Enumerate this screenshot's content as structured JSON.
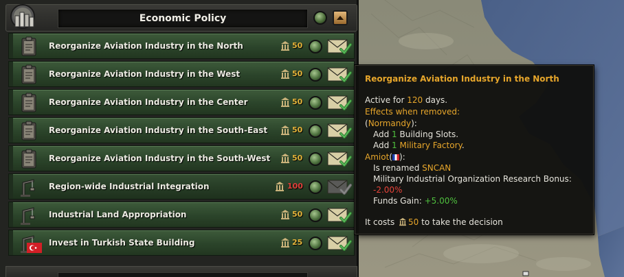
{
  "panel": {
    "title": "Economic Policy"
  },
  "decisions": [
    {
      "label": "Reorganize Aviation Industry in the North",
      "cost": "50",
      "icon": "clipboard-icon",
      "cost_color": "#e4b33a"
    },
    {
      "label": "Reorganize Aviation Industry in the West",
      "cost": "50",
      "icon": "clipboard-icon",
      "cost_color": "#e4b33a"
    },
    {
      "label": "Reorganize Aviation Industry in the Center",
      "cost": "50",
      "icon": "clipboard-icon",
      "cost_color": "#e4b33a"
    },
    {
      "label": "Reorganize Aviation Industry in the South-East",
      "cost": "50",
      "icon": "clipboard-icon",
      "cost_color": "#e4b33a"
    },
    {
      "label": "Reorganize Aviation Industry in the South-West",
      "cost": "50",
      "icon": "clipboard-icon",
      "cost_color": "#e4b33a"
    },
    {
      "label": "Region-wide Industrial Integration",
      "cost": "100",
      "icon": "crane-icon",
      "cost_color": "#e0403a"
    },
    {
      "label": "Industrial Land Appropriation",
      "cost": "50",
      "icon": "crane-icon",
      "cost_color": "#e4b33a"
    },
    {
      "label": "Invest in Turkish State Building",
      "cost": "25",
      "icon": "crane-icon",
      "cost_color": "#e4b33a"
    }
  ],
  "tooltip": {
    "title": "Reorganize Aviation Industry in the North",
    "active_prefix": "Active for ",
    "active_days": "120",
    "active_suffix": " days.",
    "effects_header": "Effects when removed:",
    "paren_open": "(",
    "state_name": "Normandy",
    "paren_close_colon": "):",
    "add1_prefix": "Add ",
    "add1_num": "1",
    "add1_suffix": " Building Slots.",
    "add2_prefix": "Add ",
    "add2_num": "1",
    "add2_suffix": " Military Factory",
    "add2_period": ".",
    "company_name": "Amiot",
    "company_close": "):",
    "renamed_prefix": "Is renamed ",
    "renamed_name": "SNCAN",
    "bonus_label": "Military Industrial Organization Research Bonus:",
    "bonus_value": "-2.00%",
    "funds_label": "Funds Gain: ",
    "funds_value": "+5.00%",
    "cost_prefix": "It costs ",
    "cost_value": "50",
    "cost_suffix": " to take the decision"
  }
}
